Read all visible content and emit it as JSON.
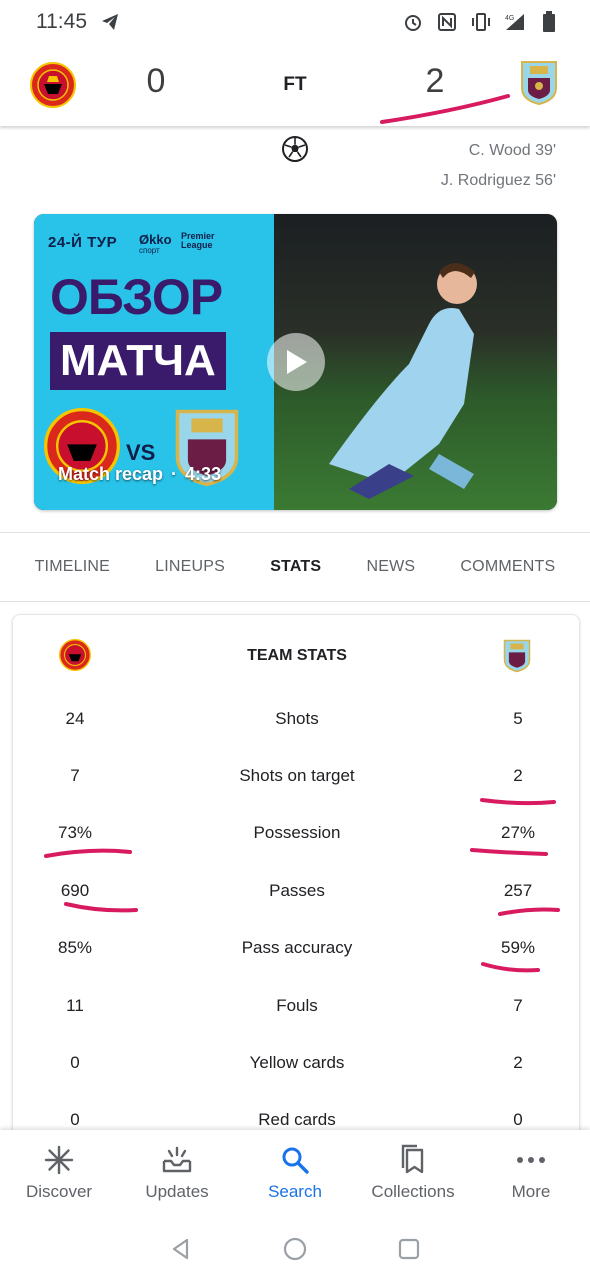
{
  "status_bar": {
    "time": "11:45",
    "icons": [
      "telegram-icon",
      "alarm-icon",
      "nfc-icon",
      "vibrate-icon",
      "4g-signal-icon",
      "battery-icon"
    ]
  },
  "match": {
    "home_team": "Manchester United",
    "away_team": "Burnley",
    "home_score": "0",
    "away_score": "2",
    "status": "FT",
    "scorers": [
      "C. Wood 39'",
      "J. Rodriguez 56'"
    ]
  },
  "video": {
    "thumb_round": "24-Й ТУР",
    "thumb_okko_line1": "Økko",
    "thumb_okko_line2": "спорт",
    "thumb_league_line1": "Premier",
    "thumb_league_line2": "League",
    "thumb_title_line1": "ОБЗОР",
    "thumb_title_line2": "МАТЧА",
    "thumb_vs": "VS",
    "label": "Match recap",
    "separator": "·",
    "duration": "4:33"
  },
  "tabs": [
    {
      "label": "TIMELINE",
      "active": false
    },
    {
      "label": "LINEUPS",
      "active": false
    },
    {
      "label": "STATS",
      "active": true
    },
    {
      "label": "NEWS",
      "active": false
    },
    {
      "label": "COMMENTS",
      "active": false
    }
  ],
  "team_stats": {
    "title": "TEAM STATS",
    "rows": [
      {
        "label": "Shots",
        "home": "24",
        "away": "5"
      },
      {
        "label": "Shots on target",
        "home": "7",
        "away": "2"
      },
      {
        "label": "Possession",
        "home": "73%",
        "away": "27%"
      },
      {
        "label": "Passes",
        "home": "690",
        "away": "257"
      },
      {
        "label": "Pass accuracy",
        "home": "85%",
        "away": "59%"
      },
      {
        "label": "Fouls",
        "home": "11",
        "away": "7"
      },
      {
        "label": "Yellow cards",
        "home": "0",
        "away": "2"
      },
      {
        "label": "Red cards",
        "home": "0",
        "away": "0"
      }
    ]
  },
  "bottom_nav": [
    {
      "label": "Discover",
      "icon": "asterisk-icon",
      "active": false
    },
    {
      "label": "Updates",
      "icon": "updates-icon",
      "active": false
    },
    {
      "label": "Search",
      "icon": "search-icon",
      "active": true
    },
    {
      "label": "Collections",
      "icon": "collections-icon",
      "active": false
    },
    {
      "label": "More",
      "icon": "more-dots-icon",
      "active": false
    }
  ],
  "colors": {
    "accent": "#1a73e8",
    "annotation": "#d81b60",
    "thumb_bg": "#29c2e8",
    "thumb_purple": "#3a1a6b",
    "mu_red": "#da291c",
    "burnley_claret": "#6c1d45",
    "burnley_blue": "#99d6ea"
  }
}
